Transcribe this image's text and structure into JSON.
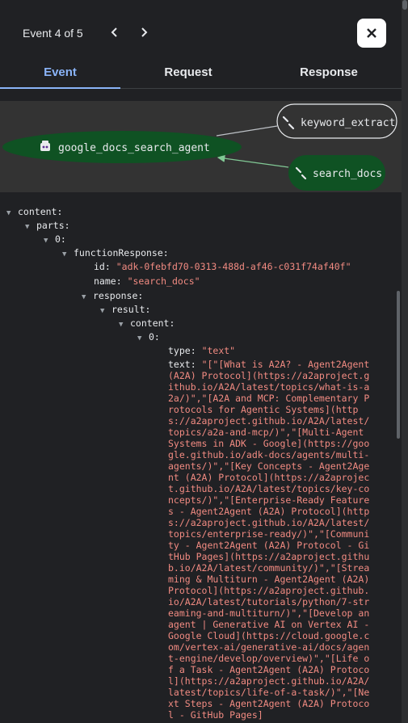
{
  "header": {
    "event_counter": "Event 4 of 5"
  },
  "tabs": [
    {
      "label": "Event"
    },
    {
      "label": "Request"
    },
    {
      "label": "Response"
    }
  ],
  "graph": {
    "nodes": [
      {
        "label": "google_docs_search_agent",
        "icon": "robot-icon"
      },
      {
        "label": "keyword_extract",
        "icon": "wrench-icon"
      },
      {
        "label": "search_docs",
        "icon": "wrench-icon"
      }
    ],
    "colors": {
      "active_node": "#0f5223",
      "edge_active": "#81c995",
      "edge": "#bdc1c6"
    }
  },
  "tree": {
    "content": "content:",
    "parts": "parts:",
    "idx0": "0:",
    "functionResponse": "functionResponse:",
    "id_key": "id:",
    "id_val": "\"adk-0febfd70-0313-488d-af46-c031f74af40f\"",
    "name_key": "name:",
    "name_val": "\"search_docs\"",
    "response": "response:",
    "result": "result:",
    "content2": "content:",
    "idx0b": "0:",
    "type_key": "type:",
    "type_val": "\"text\"",
    "text_key": "text:",
    "text_val": "\"[\"[What is A2A? - Agent2Agent (A2A) Protocol](https://a2aproject.github.io/A2A/latest/topics/what-is-a2a/)\",\"[A2A and MCP: Complementary Protocols for Agentic Systems](https://a2aproject.github.io/A2A/latest/topics/a2a-and-mcp/)\",\"[Multi-Agent Systems in ADK - Google](https://google.github.io/adk-docs/agents/multi-agents/)\",\"[Key Concepts - Agent2Agent (A2A) Protocol](https://a2aproject.github.io/A2A/latest/topics/key-concepts/)\",\"[Enterprise-Ready Features - Agent2Agent (A2A) Protocol](https://a2aproject.github.io/A2A/latest/topics/enterprise-ready/)\",\"[Community - Agent2Agent (A2A) Protocol - GitHub Pages](https://a2aproject.github.io/A2A/latest/community/)\",\"[Streaming & Multiturn - Agent2Agent (A2A) Protocol](https://a2aproject.github.io/A2A/latest/tutorials/python/7-streaming-and-multiturn/)\",\"[Develop an agent | Generative AI on Vertex AI - Google Cloud](https://cloud.google.com/vertex-ai/generative-ai/docs/agent-engine/develop/overview)\",\"[Life of a Task - Agent2Agent (A2A) Protocol](https://a2aproject.github.io/A2A/latest/topics/life-of-a-task/)\",\"[Next Steps - Agent2Agent (A2A) Protocol - GitHub Pages]"
  }
}
